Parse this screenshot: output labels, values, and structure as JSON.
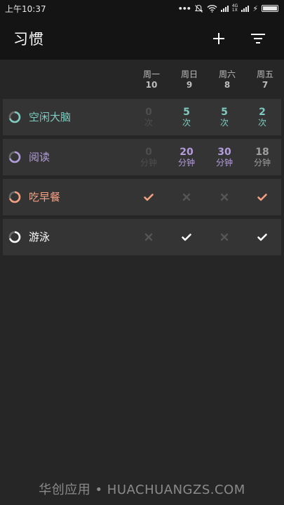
{
  "status": {
    "time": "上午10:37",
    "net_top": "4G",
    "net_bottom": "1X"
  },
  "header": {
    "title": "习惯",
    "add_icon": "plus-icon",
    "filter_icon": "filter-icon"
  },
  "days": [
    {
      "weekday": "周一",
      "date": "10"
    },
    {
      "weekday": "周日",
      "date": "9"
    },
    {
      "weekday": "周六",
      "date": "8"
    },
    {
      "weekday": "周五",
      "date": "7"
    }
  ],
  "habits": [
    {
      "name": "空闲大脑",
      "color": "#7fcbc1",
      "ring_progress": 0.7,
      "type": "numeric",
      "entries": [
        {
          "value": "0",
          "unit": "次",
          "active": false
        },
        {
          "value": "5",
          "unit": "次",
          "active": true
        },
        {
          "value": "5",
          "unit": "次",
          "active": true
        },
        {
          "value": "2",
          "unit": "次",
          "active": true
        }
      ]
    },
    {
      "name": "阅读",
      "color": "#b39ddb",
      "ring_progress": 0.7,
      "type": "numeric",
      "entries": [
        {
          "value": "0",
          "unit": "分钟",
          "active": false
        },
        {
          "value": "20",
          "unit": "分钟",
          "active": true
        },
        {
          "value": "30",
          "unit": "分钟",
          "active": true
        },
        {
          "value": "18",
          "unit": "分钟",
          "active": "muted"
        }
      ]
    },
    {
      "name": "吃早餐",
      "color": "#f4a183",
      "ring_progress": 0.7,
      "type": "boolean",
      "entries": [
        {
          "done": true
        },
        {
          "done": false
        },
        {
          "done": false
        },
        {
          "done": true
        }
      ]
    },
    {
      "name": "游泳",
      "color": "#ffffff",
      "ring_progress": 0.7,
      "type": "boolean",
      "entries": [
        {
          "done": false
        },
        {
          "done": true
        },
        {
          "done": false
        },
        {
          "done": true
        }
      ]
    }
  ],
  "watermark": "华创应用 • HUACHUANGZS.COM"
}
